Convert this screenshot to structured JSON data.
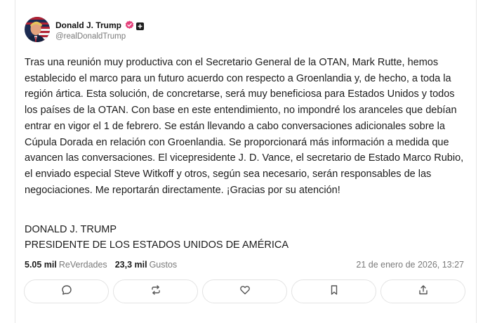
{
  "author": {
    "name": "Donald J. Trump",
    "handle": "@realDonaldTrump",
    "verified_color": "#e4407a"
  },
  "post": {
    "paragraphs": [
      "Tras una reunión muy productiva con el Secretario General de la OTAN, Mark Rutte, hemos establecido el marco para un futuro acuerdo con respecto a Groenlandia y, de hecho, a toda la región ártica. Esta solución, de concretarse, será muy beneficiosa para Estados Unidos y todos los países de la OTAN. Con base en este entendimiento, no impondré los aranceles que debían entrar en vigor el 1 de febrero. Se están llevando a cabo conversaciones adicionales sobre la Cúpula Dorada en relación con Groenlandia. Se proporcionará más información a medida que avancen las conversaciones. El vicepresidente J. D. Vance, el secretario de Estado Marco Rubio, el enviado especial Steve Witkoff y otros, según sea necesario, serán responsables de las negociaciones. Me reportarán directamente. ¡Gracias por su atención!"
    ],
    "signature_line1": "DONALD J. TRUMP",
    "signature_line2": "PRESIDENTE DE LOS ESTADOS UNIDOS DE AMÉRICA"
  },
  "stats": {
    "reposts_count": "5.05 mil",
    "reposts_label": "ReVerdades",
    "likes_count": "23,3 mil",
    "likes_label": "Gustos",
    "timestamp": "21 de enero de 2026, 13:27"
  },
  "actions": [
    {
      "icon": "comment-icon"
    },
    {
      "icon": "repost-icon"
    },
    {
      "icon": "heart-icon"
    },
    {
      "icon": "bookmark-icon"
    },
    {
      "icon": "share-icon"
    }
  ]
}
